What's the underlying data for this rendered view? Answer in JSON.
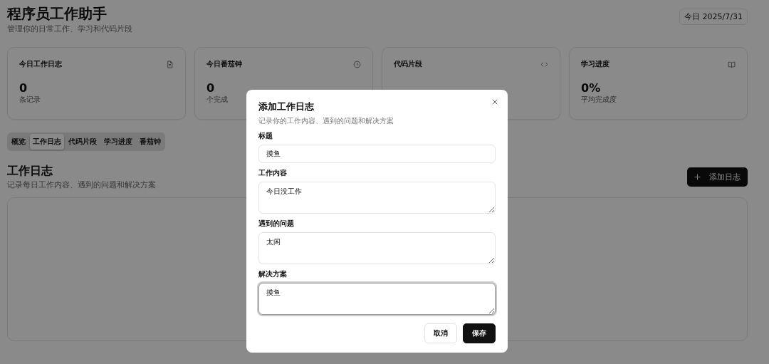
{
  "header": {
    "title": "程序员工作助手",
    "subtitle": "管理你的日常工作、学习和代码片段",
    "date_badge": "今日 2025/7/31"
  },
  "stat_cards": [
    {
      "title": "今日工作日志",
      "value": "0",
      "caption": "条记录"
    },
    {
      "title": "今日番茄钟",
      "value": "0",
      "caption": "个完成"
    },
    {
      "title": "代码片段"
    },
    {
      "title": "学习进度",
      "value": "0%",
      "caption": "平均完成度"
    }
  ],
  "tabs": [
    {
      "label": "概览",
      "selected": false
    },
    {
      "label": "工作日志",
      "selected": true
    },
    {
      "label": "代码片段",
      "selected": false
    },
    {
      "label": "学习进度",
      "selected": false
    },
    {
      "label": "番茄钟",
      "selected": false
    }
  ],
  "section": {
    "title": "工作日志",
    "subtitle": "记录每日工作内容、遇到的问题和解决方案",
    "add_button": "添加日志"
  },
  "dialog": {
    "title": "添加工作日志",
    "subtitle": "记录你的工作内容、遇到的问题和解决方案",
    "fields": [
      {
        "label": "标题",
        "kind": "input",
        "value": "摸鱼",
        "focused": false
      },
      {
        "label": "工作内容",
        "kind": "textarea",
        "value": "今日没工作",
        "focused": false
      },
      {
        "label": "遇到的问题",
        "kind": "textarea",
        "value": "太闲",
        "focused": false
      },
      {
        "label": "解决方案",
        "kind": "textarea",
        "value": "摸鱼",
        "focused": true
      }
    ],
    "buttons": [
      {
        "label": "取消",
        "kind": "secondary"
      },
      {
        "label": "保存",
        "kind": "primary"
      }
    ]
  }
}
